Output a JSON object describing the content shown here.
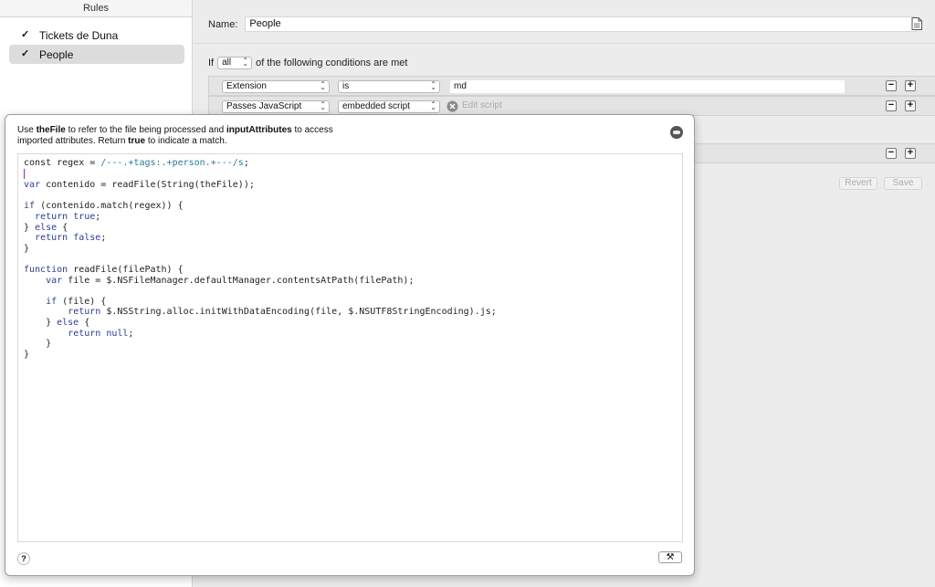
{
  "sidebar": {
    "header": "Rules",
    "items": [
      {
        "label": "Tickets de Duna",
        "checked": true,
        "selected": false
      },
      {
        "label": "People",
        "checked": true,
        "selected": true
      }
    ]
  },
  "main": {
    "name_label": "Name:",
    "name_value": "People",
    "conditions_prefix": "If",
    "match_mode": "all",
    "conditions_suffix": "of the following conditions are met",
    "conditions": [
      {
        "attribute": "Extension",
        "operator": "is",
        "value": "md"
      },
      {
        "attribute": "Passes JavaScript",
        "operator": "embedded script",
        "action_placeholder": "Edit script"
      }
    ],
    "revert_label": "Revert",
    "save_label": "Save",
    "remove_symbol": "−",
    "add_symbol": "+"
  },
  "popover": {
    "help_parts": [
      "Use ",
      "theFile",
      " to refer to the file being processed and ",
      "inputAttributes",
      " to access imported attributes. Return ",
      "true",
      " to indicate a match."
    ],
    "code_lines": [
      "const regex = /---.+tags:.+person.+---/s;",
      "",
      "var contenido = readFile(String(theFile));",
      "",
      "if (contenido.match(regex)) {",
      "  return true;",
      "} else {",
      "  return false;",
      "}",
      "",
      "function readFile(filePath) {",
      "    var file = $.NSFileManager.defaultManager.contentsAtPath(filePath);",
      "",
      "    if (file) {",
      "        return $.NSString.alloc.initWithDataEncoding(file, $.NSUTF8StringEncoding).js;",
      "    } else {",
      "        return null;",
      "    }",
      "}"
    ],
    "help_button": "?",
    "build_button": "⚒",
    "close_icon": "close-icon"
  },
  "colors": {
    "keyword": "#2b3aa6",
    "regex": "#2a7a9a",
    "cursor": "#8a2be2"
  }
}
